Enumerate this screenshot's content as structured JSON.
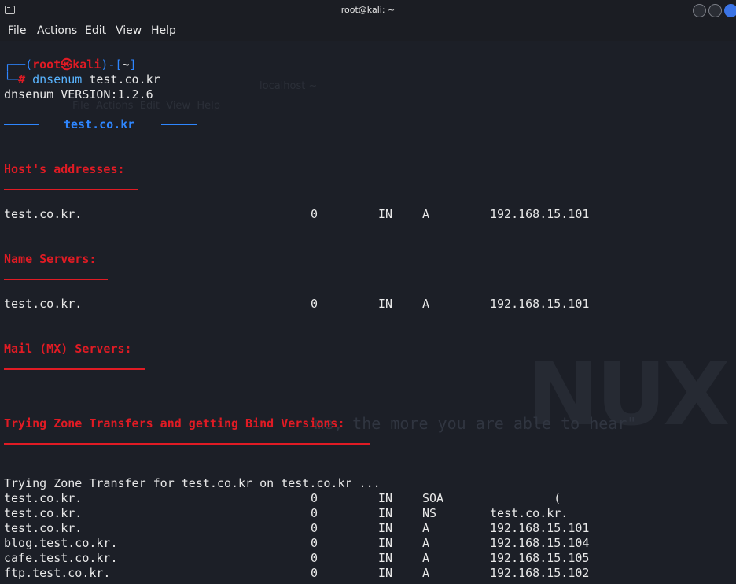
{
  "window": {
    "title": "root@kali: ~"
  },
  "menu": [
    "File",
    "Actions",
    "Edit",
    "View",
    "Help"
  ],
  "prompt": {
    "open": "┌──(",
    "user": "root㉿kali",
    "mid": ")-[",
    "path": "~",
    "close": "]",
    "line2_prefix": "└─",
    "hash": "#",
    "cmd": "dnsenum",
    "arg": "test.co.kr"
  },
  "version_line": "dnsenum VERSION:1.2.6",
  "domain_banner": "test.co.kr",
  "sections": {
    "hosts": "Host's addresses:",
    "ns": "Name Servers:",
    "mx": "Mail (MX) Servers:",
    "zone": "Trying Zone Transfers and getting Bind Versions:"
  },
  "host_records": [
    {
      "name": "test.co.kr.",
      "ttl": "0",
      "class": "IN",
      "type": "A",
      "value": "192.168.15.101"
    }
  ],
  "ns_records": [
    {
      "name": "test.co.kr.",
      "ttl": "0",
      "class": "IN",
      "type": "A",
      "value": "192.168.15.101"
    }
  ],
  "zone_transfer_line": "Trying Zone Transfer for test.co.kr on test.co.kr ...",
  "zone_records": [
    {
      "name": "test.co.kr.",
      "ttl": "0",
      "class": "IN",
      "type": "SOA",
      "value": "         ("
    },
    {
      "name": "test.co.kr.",
      "ttl": "0",
      "class": "IN",
      "type": "NS",
      "value": "test.co.kr."
    },
    {
      "name": "test.co.kr.",
      "ttl": "0",
      "class": "IN",
      "type": "A",
      "value": "192.168.15.101"
    },
    {
      "name": "blog.test.co.kr.",
      "ttl": "0",
      "class": "IN",
      "type": "A",
      "value": "192.168.15.104"
    },
    {
      "name": "cafe.test.co.kr.",
      "ttl": "0",
      "class": "IN",
      "type": "A",
      "value": "192.168.15.105"
    },
    {
      "name": "ftp.test.co.kr.",
      "ttl": "0",
      "class": "IN",
      "type": "A",
      "value": "192.168.15.102"
    }
  ],
  "watermark": {
    "brand": "NUX",
    "quote": "me, the more you are able to hear\"",
    "inner_title": "localhost ~",
    "inner_menu": "File  Actions  Edit  View  Help"
  },
  "colors": {
    "background": "#1c1f27",
    "section_red": "#e01b24",
    "accent_blue": "#2e86ff",
    "text": "#e8e8e8"
  }
}
